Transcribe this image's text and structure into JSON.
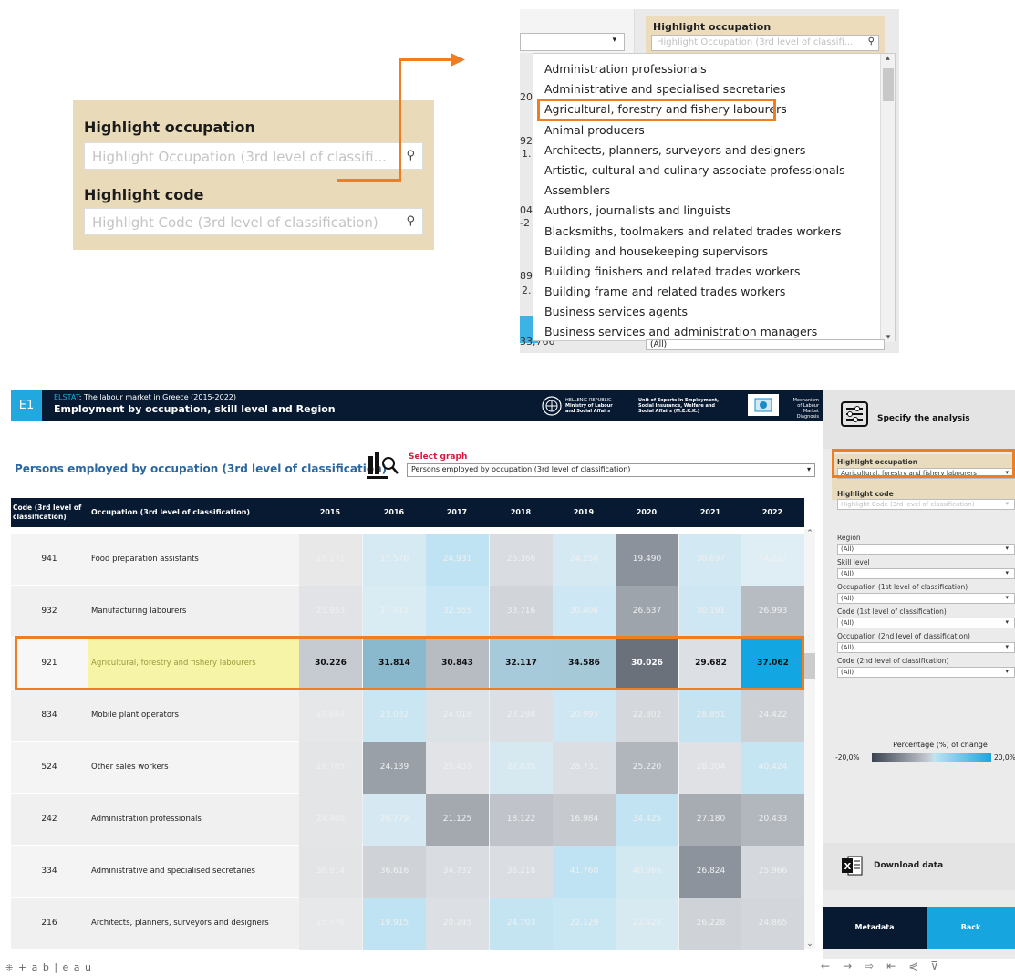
{
  "zoom_filter": {
    "highlight_occupation_label": "Highlight occupation",
    "highlight_occupation_placeholder": "Highlight Occupation (3rd level of classifi...",
    "highlight_code_label": "Highlight code",
    "highlight_code_placeholder": "Highlight Code (3rd level of classification)"
  },
  "zoom_dropdown": {
    "label": "Highlight occupation",
    "placeholder": "Highlight Occupation (3rd level of classifi...",
    "items": [
      "Administration professionals",
      "Administrative and specialised secretaries",
      "Agricultural, forestry and fishery labourers",
      "Animal producers",
      "Architects, planners, surveyors and designers",
      "Artistic, cultural and culinary associate professionals",
      "Assemblers",
      "Authors, journalists and linguists",
      "Blacksmiths, toolmakers and related trades workers",
      "Building and housekeeping supervisors",
      "Building finishers and related trades workers",
      "Building frame and related trades workers",
      "Business services agents",
      "Business services and administration managers"
    ],
    "selected_index": 2,
    "bg_fragments": [
      "20",
      "92",
      "1.",
      "04",
      "-2",
      "89",
      "2.",
      "33,766"
    ],
    "bottom_select": "(All)"
  },
  "header": {
    "badge": "E1",
    "source": "ELSTAT",
    "subtitle": ": The labour market in Greece (2015-2022)",
    "title": "Employment by occupation, skill level and Region",
    "logo1_a": "HELLENIC REPUBLIC",
    "logo1_b": "Ministry of Labour",
    "logo1_c": "and Social Affairs",
    "logo2_a": "Unit of Experts in Employment,",
    "logo2_b": "Social Insurance, Welfare and",
    "logo2_c": "Social Affairs (M.E.K.K.)",
    "logo3_a": "Mechanism",
    "logo3_b": "of Labour",
    "logo3_c": "Market Diagnosis"
  },
  "main": {
    "panel_title": "Persons employed by occupation (3rd level of classification)",
    "select_graph_label": "Select graph",
    "select_graph_value": "Persons employed by occupation (3rd level of classification)",
    "col_code": "Code (3rd level of classification)",
    "col_occ": "Occupation (3rd level of classification)",
    "years": [
      "2015",
      "2016",
      "2017",
      "2018",
      "2019",
      "2020",
      "2021",
      "2022"
    ],
    "rows": [
      {
        "code": "941",
        "occ": "Food preparation assistants",
        "v": [
          "16.171",
          "17.570",
          "24.931",
          "25.366",
          "24.250",
          "19.490",
          "30.697",
          "34.227"
        ],
        "c": [
          "#e8e8e8",
          "#d6eaf3",
          "#bfe3f2",
          "#d9dce0",
          "#d4e9f2",
          "#8b929b",
          "#d2e8f2",
          "#dfeef5"
        ]
      },
      {
        "code": "932",
        "occ": "Manufacturing labourers",
        "v": [
          "25.953",
          "27.711",
          "32.555",
          "33.716",
          "30.406",
          "26.637",
          "30.191",
          "26.993"
        ],
        "c": [
          "#e1e3e6",
          "#d9ecf4",
          "#c8e6f3",
          "#d1d5da",
          "#cde8f4",
          "#9ea4ab",
          "#cfe7f2",
          "#b7bcc3"
        ]
      },
      {
        "code": "921",
        "occ": "Agricultural, forestry and fishery labourers",
        "v": [
          "30.226",
          "31.814",
          "30.843",
          "32.117",
          "34.586",
          "30.026",
          "29.682",
          "37.062"
        ],
        "c": [
          "#c6cbd1",
          "#8ab8cc",
          "#b7bcc3",
          "#a7cada",
          "#a6c9d8",
          "#6a717b",
          "#dcdfe3",
          "#12a6e2"
        ]
      },
      {
        "code": "834",
        "occ": "Mobile plant operators",
        "v": [
          "18.684",
          "23.032",
          "24.018",
          "23.298",
          "20.995",
          "22.802",
          "28.851",
          "24.422"
        ],
        "c": [
          "#e6e7e9",
          "#c9e6f2",
          "#dde2e6",
          "#dcdfe3",
          "#cfe7f2",
          "#d4d7db",
          "#c5e3f1",
          "#cdd1d6"
        ]
      },
      {
        "code": "524",
        "occ": "Other sales workers",
        "v": [
          "28.705",
          "24.139",
          "25.433",
          "27.835",
          "28.731",
          "25.220",
          "28.304",
          "40.424"
        ],
        "c": [
          "#e4e5e7",
          "#9aa0a8",
          "#e1e3e6",
          "#d6e9f1",
          "#dbdee2",
          "#b1b6bd",
          "#dfe1e4",
          "#c6e5f2"
        ]
      },
      {
        "code": "242",
        "occ": "Administration professionals",
        "v": [
          "24.408",
          "26.779",
          "21.125",
          "18.122",
          "16.984",
          "34.425",
          "27.180",
          "20.433"
        ],
        "c": [
          "#e4e5e7",
          "#d6e9f2",
          "#a4a9b0",
          "#c0c4ca",
          "#c6cacf",
          "#c2e3f1",
          "#a7acb3",
          "#b2b7bd"
        ]
      },
      {
        "code": "334",
        "occ": "Administrative and specialised secretaries",
        "v": [
          "38.914",
          "36.616",
          "34.732",
          "36.218",
          "41.760",
          "40.966",
          "26.824",
          "25.966"
        ],
        "c": [
          "#e3e4e6",
          "#cfd3d7",
          "#d9dce0",
          "#dadde1",
          "#bfe3f2",
          "#d3e9f2",
          "#8c939c",
          "#d5d8dc"
        ]
      },
      {
        "code": "216",
        "occ": "Architects, planners, surveyors and designers",
        "v": [
          "15.776",
          "19.915",
          "20.245",
          "24.703",
          "22.129",
          "22.428",
          "26.228",
          "24.865"
        ],
        "c": [
          "#e7e8ea",
          "#bfe3f2",
          "#dcdfe3",
          "#c5e4f2",
          "#c9e6f3",
          "#d7eaf2",
          "#cfd2d7",
          "#d3d6da"
        ]
      }
    ]
  },
  "sidebar": {
    "specify": "Specify the analysis",
    "hl_occ_label": "Highlight occupation",
    "hl_occ_value": "Agricultural, forestry and fishery labourers",
    "hl_code_label": "Highlight code",
    "hl_code_placeholder": "Highlight Code (3rd level of classification)",
    "filters": [
      {
        "label": "Region",
        "value": "(All)"
      },
      {
        "label": "Skill level",
        "value": "(All)"
      },
      {
        "label": "Occupation (1st level of classification)",
        "value": "(All)"
      },
      {
        "label": "Code (1st level of classification)",
        "value": "(All)"
      },
      {
        "label": "Occupation (2nd level of classification)",
        "value": "(All)"
      },
      {
        "label": "Code (2nd level of classification)",
        "value": "(All)"
      }
    ],
    "legend_title": "Percentage (%) of change",
    "legend_min": "-20,0%",
    "legend_max": "20,0%",
    "download": "Download data",
    "metadata": "Metadata",
    "back": "Back"
  },
  "footer": {
    "brand": "+ a b | e a u"
  },
  "colors": {
    "accent": "#ef7d22",
    "navy": "#081a32",
    "blue": "#17a5e0"
  }
}
